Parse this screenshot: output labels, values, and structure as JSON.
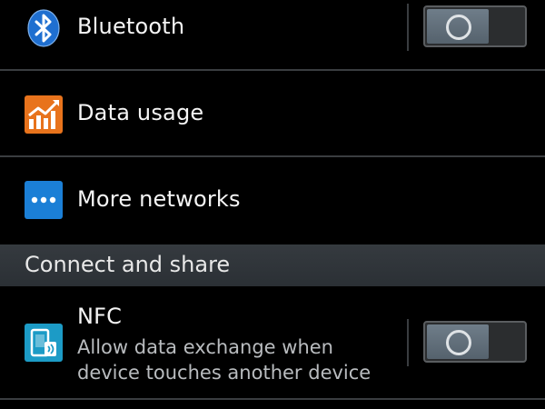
{
  "settings": {
    "bluetooth": {
      "label": "Bluetooth",
      "icon": "bluetooth-icon",
      "toggle_on": false
    },
    "data_usage": {
      "label": "Data usage",
      "icon": "data-usage-chart-icon"
    },
    "more_networks": {
      "label": "More networks",
      "icon": "more-dots-icon"
    }
  },
  "section": {
    "title": "Connect and share"
  },
  "nfc": {
    "label": "NFC",
    "description_line1": "Allow data exchange when",
    "description_line2": "device touches another device",
    "icon": "nfc-phone-icon",
    "toggle_on": false
  },
  "colors": {
    "background": "#000000",
    "divider": "#3a3d40",
    "section_header": "#30353a",
    "bluetooth_blue": "#1f6fd0",
    "data_usage_orange": "#e8731c",
    "more_networks_blue": "#1b7fd6",
    "nfc_teal": "#1c9bc6"
  }
}
